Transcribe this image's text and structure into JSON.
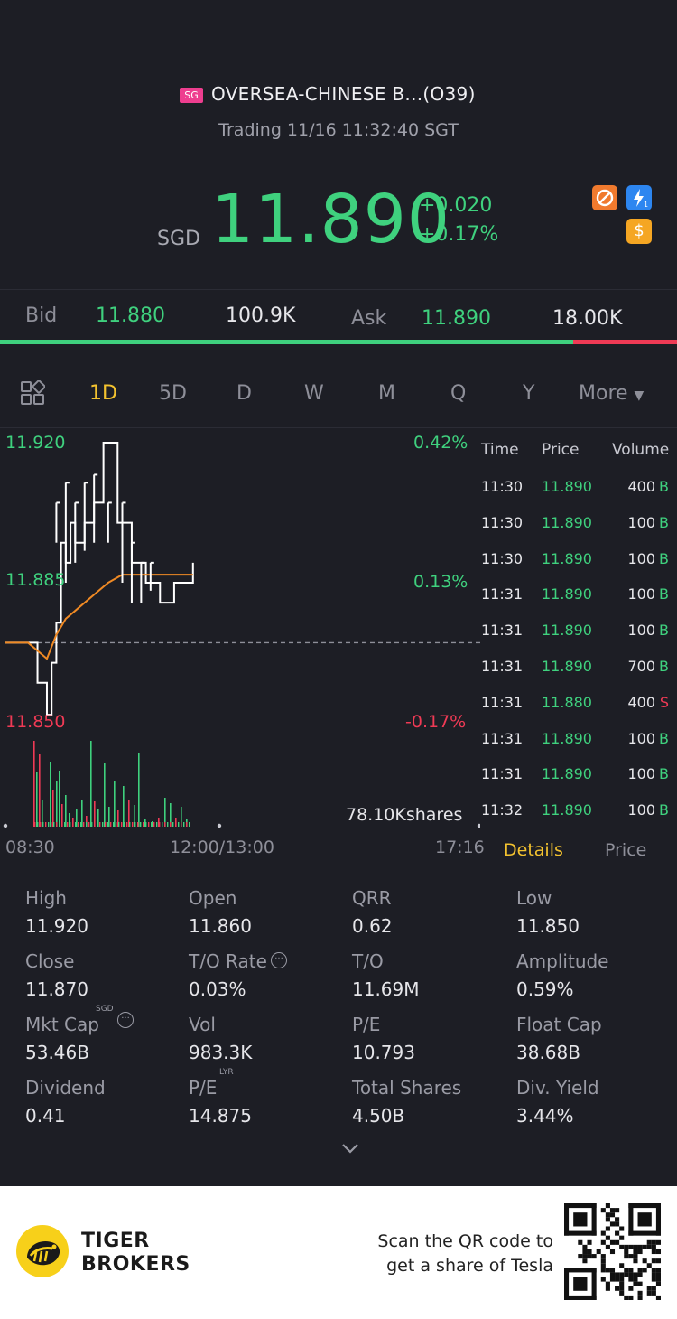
{
  "header": {
    "market_badge": "SG",
    "stock_name": "OVERSEA-CHINESE B...(O39)",
    "trading_status": "Trading 11/16 11:32:40 SGT",
    "currency": "SGD",
    "price": "11.890",
    "change": "+0.020",
    "change_pct": "+0.17%",
    "icons": [
      "no-short-icon",
      "lightning-level1-icon",
      "dollar-icon"
    ]
  },
  "quote": {
    "bid_label": "Bid",
    "bid_price": "11.880",
    "bid_size": "100.9K",
    "ask_label": "Ask",
    "ask_price": "11.890",
    "ask_size": "18.00K",
    "bid_ratio": 0.847
  },
  "tabs": {
    "items": [
      "1D",
      "5D",
      "D",
      "W",
      "M",
      "Q",
      "Y"
    ],
    "active": "1D",
    "more_label": "More"
  },
  "chart_data": {
    "type": "line",
    "title": "",
    "y_labels_left": [
      "11.920",
      "11.885",
      "11.850"
    ],
    "y_labels_right": [
      "0.42%",
      "0.13%",
      "-0.17%"
    ],
    "x_labels": [
      "08:30",
      "12:00/13:00",
      "17:16"
    ],
    "prev_close": 11.87,
    "ylim": [
      11.85,
      11.92
    ],
    "volume_label": "78.10Kshares",
    "series": [
      {
        "name": "",
        "color": "#ffffff",
        "x": [
          0,
          0.04,
          0.07,
          0.09,
          0.1,
          0.11,
          0.12,
          0.13,
          0.14,
          0.15,
          0.17,
          0.19,
          0.21,
          0.24,
          0.27,
          0.3,
          0.33,
          0.36,
          0.4
        ],
        "y": [
          11.87,
          11.87,
          11.86,
          11.852,
          11.865,
          11.875,
          11.895,
          11.89,
          11.9,
          11.895,
          11.9,
          11.905,
          11.92,
          11.9,
          11.89,
          11.885,
          11.88,
          11.885,
          11.89
        ]
      },
      {
        "name": "",
        "color": "#f08a24",
        "x": [
          0,
          0.05,
          0.09,
          0.11,
          0.13,
          0.16,
          0.19,
          0.22,
          0.25,
          0.3,
          0.35,
          0.4
        ],
        "y": [
          11.87,
          11.87,
          11.866,
          11.872,
          11.876,
          11.879,
          11.882,
          11.885,
          11.887,
          11.887,
          11.887,
          11.887
        ]
      }
    ]
  },
  "time_sales": {
    "headers": [
      "Time",
      "Price",
      "Volume"
    ],
    "rows": [
      {
        "time": "11:30",
        "price": "11.890",
        "volume": "400",
        "side": "B"
      },
      {
        "time": "11:30",
        "price": "11.890",
        "volume": "100",
        "side": "B"
      },
      {
        "time": "11:30",
        "price": "11.890",
        "volume": "100",
        "side": "B"
      },
      {
        "time": "11:31",
        "price": "11.890",
        "volume": "100",
        "side": "B"
      },
      {
        "time": "11:31",
        "price": "11.890",
        "volume": "100",
        "side": "B"
      },
      {
        "time": "11:31",
        "price": "11.890",
        "volume": "700",
        "side": "B"
      },
      {
        "time": "11:31",
        "price": "11.880",
        "volume": "400",
        "side": "S"
      },
      {
        "time": "11:31",
        "price": "11.890",
        "volume": "100",
        "side": "B"
      },
      {
        "time": "11:31",
        "price": "11.890",
        "volume": "100",
        "side": "B"
      },
      {
        "time": "11:32",
        "price": "11.890",
        "volume": "100",
        "side": "B"
      }
    ],
    "details_tab": "Details",
    "price_tab": "Price"
  },
  "stats": {
    "high": {
      "label": "High",
      "value": "11.920"
    },
    "open": {
      "label": "Open",
      "value": "11.860"
    },
    "qrr": {
      "label": "QRR",
      "value": "0.62"
    },
    "low": {
      "label": "Low",
      "value": "11.850"
    },
    "close": {
      "label": "Close",
      "value": "11.870"
    },
    "to_rate": {
      "label": "T/O Rate",
      "value": "0.03%"
    },
    "to": {
      "label": "T/O",
      "value": "11.69M"
    },
    "amplitude": {
      "label": "Amplitude",
      "value": "0.59%"
    },
    "mkt_cap": {
      "label": "Mkt Cap",
      "value": "53.46B",
      "sup": "SGD"
    },
    "vol": {
      "label": "Vol",
      "value": "983.3K"
    },
    "pe": {
      "label": "P/E",
      "value": "10.793"
    },
    "float_cap": {
      "label": "Float Cap",
      "value": "38.68B"
    },
    "dividend": {
      "label": "Dividend",
      "value": "0.41"
    },
    "pe_lyr": {
      "label": "P/E",
      "value": "14.875",
      "sup": "LYR"
    },
    "total_shares": {
      "label": "Total Shares",
      "value": "4.50B"
    },
    "div_yield": {
      "label": "Div. Yield",
      "value": "3.44%"
    }
  },
  "footer": {
    "brand_line1": "TIGER",
    "brand_line2": "BROKERS",
    "scan_line1": "Scan the QR code to",
    "scan_line2": "get a share of Tesla"
  },
  "colors": {
    "up": "#3fd17e",
    "down": "#ef3a55",
    "accent": "#f3c22f",
    "background": "#1d1e25"
  }
}
